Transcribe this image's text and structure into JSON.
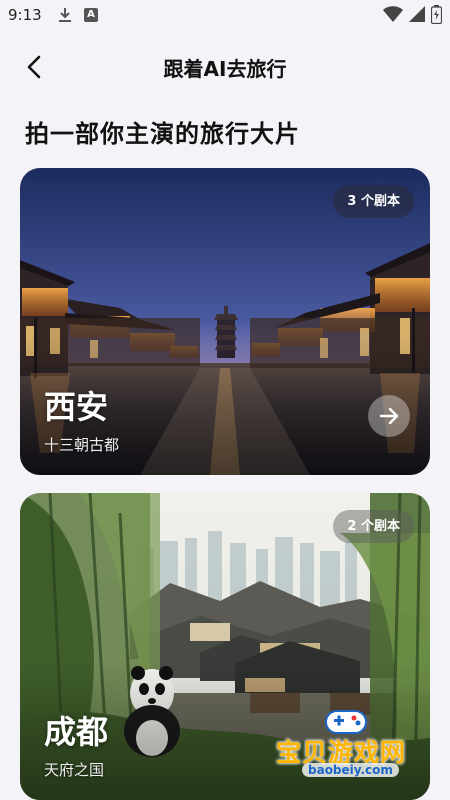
{
  "status_bar": {
    "time": "9:13"
  },
  "header": {
    "title": "跟着AI去旅行"
  },
  "headline": "拍一部你主演的旅行大片",
  "cards": [
    {
      "city": "西安",
      "subtitle": "十三朝古都",
      "badge": "3 个剧本"
    },
    {
      "city": "成都",
      "subtitle": "天府之国",
      "badge": "2 个剧本"
    }
  ],
  "watermark": {
    "text": "宝贝游戏网",
    "url": "baobeiy.com"
  },
  "colors": {
    "background": "#f4f3f8",
    "watermark": "#ffb400",
    "watermark_url": "#1b67c9"
  },
  "icons": [
    "download-icon",
    "a-icon",
    "wifi-icon",
    "signal-icon",
    "battery-icon",
    "back-arrow-icon",
    "arrow-right-icon",
    "gamepad-icon"
  ]
}
